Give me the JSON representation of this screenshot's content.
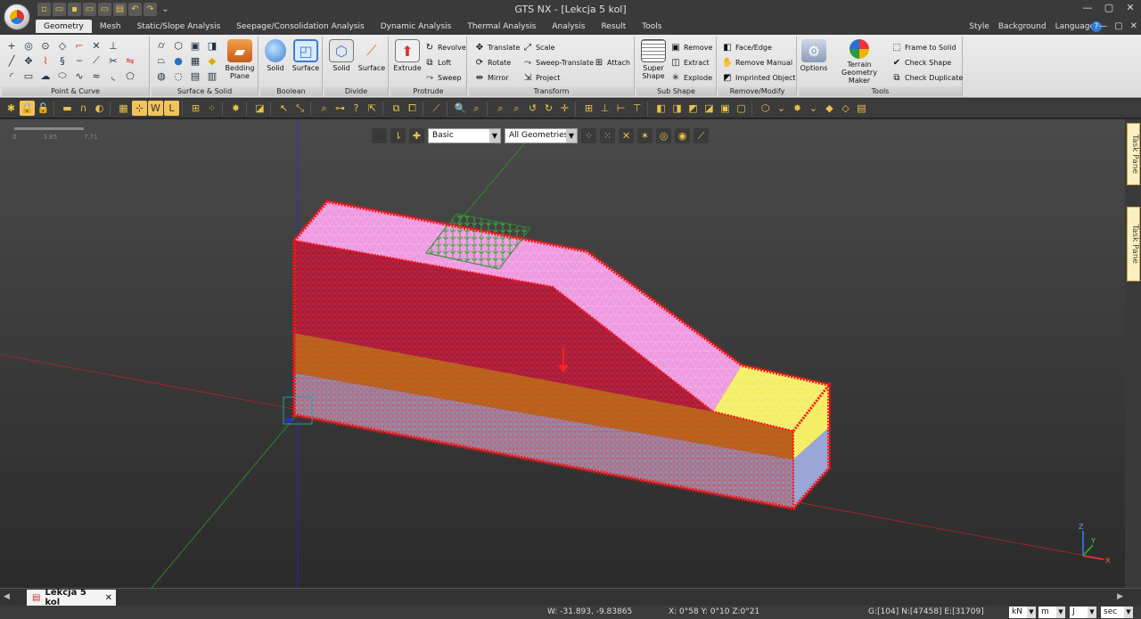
{
  "window": {
    "title": "GTS NX - [Lekcja 5 kol]"
  },
  "ribbon_tabs": [
    "Geometry",
    "Mesh",
    "Static/Slope Analysis",
    "Seepage/Consolidation Analysis",
    "Dynamic Analysis",
    "Thermal Analysis",
    "Analysis",
    "Result",
    "Tools"
  ],
  "right_menu": [
    "Style",
    "Background",
    "Language"
  ],
  "groups": {
    "point_curve": "Point & Curve",
    "surface_solid": "Surface & Solid",
    "boolean": "Boolean",
    "divide": "Divide",
    "protrude": "Protrude",
    "transform": "Transform",
    "sub_shape": "Sub Shape",
    "remove_modify": "Remove/Modify",
    "tools": "Tools"
  },
  "buttons": {
    "bedding_plane": "Bedding Plane",
    "boolean_solid": "Solid",
    "boolean_surface": "Surface",
    "divide_solid": "Solid",
    "divide_surface": "Surface",
    "extrude": "Extrude",
    "revolve": "Revolve",
    "loft": "Loft",
    "sweep": "Sweep",
    "translate": "Translate",
    "rotate": "Rotate",
    "mirror": "Mirror",
    "scale": "Scale",
    "sweep_translate": "Sweep-Translate",
    "project": "Project",
    "attach": "Attach",
    "super_shape": "Super Shape",
    "remove": "Remove",
    "extract": "Extract",
    "explode": "Explode",
    "face_edge": "Face/Edge",
    "remove_manual": "Remove Manual",
    "imprinted_object": "Imprinted Object",
    "options": "Options",
    "terrain_geometry_maker": "Terrain Geometry Maker",
    "frame_to_solid": "Frame to Solid",
    "check_shape": "Check Shape",
    "check_duplicate": "Check Duplicate"
  },
  "viewport": {
    "scale_labels": [
      "0",
      "3.85",
      "7.71"
    ],
    "display_mode": "Basic",
    "geometry_filter": "All Geometries ("
  },
  "task_pane": [
    "Task Pane",
    "Task Pane"
  ],
  "document_tab": "Lekcja 5 kol",
  "statusbar": {
    "coords": "W: -31.893, -9.83865",
    "angles": "X: 0°58 Y: 0°10 Z:0°21",
    "counts": "G:[104] N:[47458] E:[31709]",
    "units": [
      "kN",
      "m",
      "J",
      "sec"
    ]
  },
  "colors": {
    "top_face": "#ee99e0",
    "side_red": "#a31d3e",
    "middle_layer": "#b06a1c",
    "bottom_layer": "#8d90b0",
    "right_top": "#f4ee66",
    "load": "#2d8a2d",
    "edges": "#ff1010"
  }
}
